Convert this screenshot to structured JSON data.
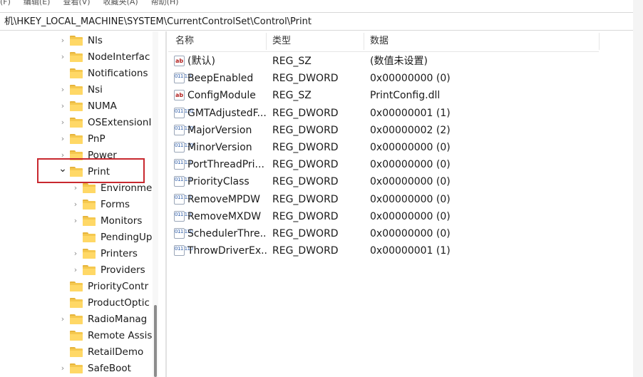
{
  "menubar": {
    "items": [
      "(F)",
      "编辑(E)",
      "查看(V)",
      "收藏夹(A)",
      "帮助(H)"
    ]
  },
  "address": {
    "path": "机\\HKEY_LOCAL_MACHINE\\SYSTEM\\CurrentControlSet\\Control\\Print"
  },
  "tree": {
    "items": [
      {
        "label": "Nls",
        "expandable": true,
        "level": 0
      },
      {
        "label": "NodeInterfac",
        "expandable": true,
        "level": 0
      },
      {
        "label": "Notifications",
        "expandable": false,
        "level": 0
      },
      {
        "label": "Nsi",
        "expandable": true,
        "level": 0
      },
      {
        "label": "NUMA",
        "expandable": true,
        "level": 0
      },
      {
        "label": "OSExtensionI",
        "expandable": true,
        "level": 0
      },
      {
        "label": "PnP",
        "expandable": true,
        "level": 0
      },
      {
        "label": "Power",
        "expandable": true,
        "level": 0
      },
      {
        "label": "Print",
        "expandable": true,
        "expanded": true,
        "level": 0,
        "selected": true
      },
      {
        "label": "Environme",
        "expandable": true,
        "level": 1
      },
      {
        "label": "Forms",
        "expandable": true,
        "level": 1
      },
      {
        "label": "Monitors",
        "expandable": true,
        "level": 1
      },
      {
        "label": "PendingUp",
        "expandable": false,
        "level": 1
      },
      {
        "label": "Printers",
        "expandable": true,
        "level": 1
      },
      {
        "label": "Providers",
        "expandable": true,
        "level": 1
      },
      {
        "label": "PriorityContr",
        "expandable": false,
        "level": 0
      },
      {
        "label": "ProductOptic",
        "expandable": false,
        "level": 0
      },
      {
        "label": "RadioManag",
        "expandable": true,
        "level": 0
      },
      {
        "label": "Remote Assis",
        "expandable": false,
        "level": 0
      },
      {
        "label": "RetailDemo",
        "expandable": false,
        "level": 0
      },
      {
        "label": "SafeBoot",
        "expandable": true,
        "level": 0
      }
    ]
  },
  "list": {
    "headers": {
      "name": "名称",
      "type": "类型",
      "data": "数据"
    },
    "rows": [
      {
        "icon": "string-value-icon",
        "name": "(默认)",
        "type": "REG_SZ",
        "data": "(数值未设置)"
      },
      {
        "icon": "binary-value-icon",
        "name": "BeepEnabled",
        "type": "REG_DWORD",
        "data": "0x00000000 (0)"
      },
      {
        "icon": "string-value-icon",
        "name": "ConfigModule",
        "type": "REG_SZ",
        "data": "PrintConfig.dll"
      },
      {
        "icon": "binary-value-icon",
        "name": "GMTAdjustedF...",
        "type": "REG_DWORD",
        "data": "0x00000001 (1)"
      },
      {
        "icon": "binary-value-icon",
        "name": "MajorVersion",
        "type": "REG_DWORD",
        "data": "0x00000002 (2)"
      },
      {
        "icon": "binary-value-icon",
        "name": "MinorVersion",
        "type": "REG_DWORD",
        "data": "0x00000000 (0)"
      },
      {
        "icon": "binary-value-icon",
        "name": "PortThreadPri...",
        "type": "REG_DWORD",
        "data": "0x00000000 (0)"
      },
      {
        "icon": "binary-value-icon",
        "name": "PriorityClass",
        "type": "REG_DWORD",
        "data": "0x00000000 (0)"
      },
      {
        "icon": "binary-value-icon",
        "name": "RemoveMPDW",
        "type": "REG_DWORD",
        "data": "0x00000000 (0)"
      },
      {
        "icon": "binary-value-icon",
        "name": "RemoveMXDW",
        "type": "REG_DWORD",
        "data": "0x00000000 (0)"
      },
      {
        "icon": "binary-value-icon",
        "name": "SchedulerThre...",
        "type": "REG_DWORD",
        "data": "0x00000000 (0)"
      },
      {
        "icon": "binary-value-icon",
        "name": "ThrowDriverEx...",
        "type": "REG_DWORD",
        "data": "0x00000001 (1)"
      }
    ]
  },
  "colors": {
    "highlight_border": "#c8282f",
    "folder": "#f5c84f"
  }
}
